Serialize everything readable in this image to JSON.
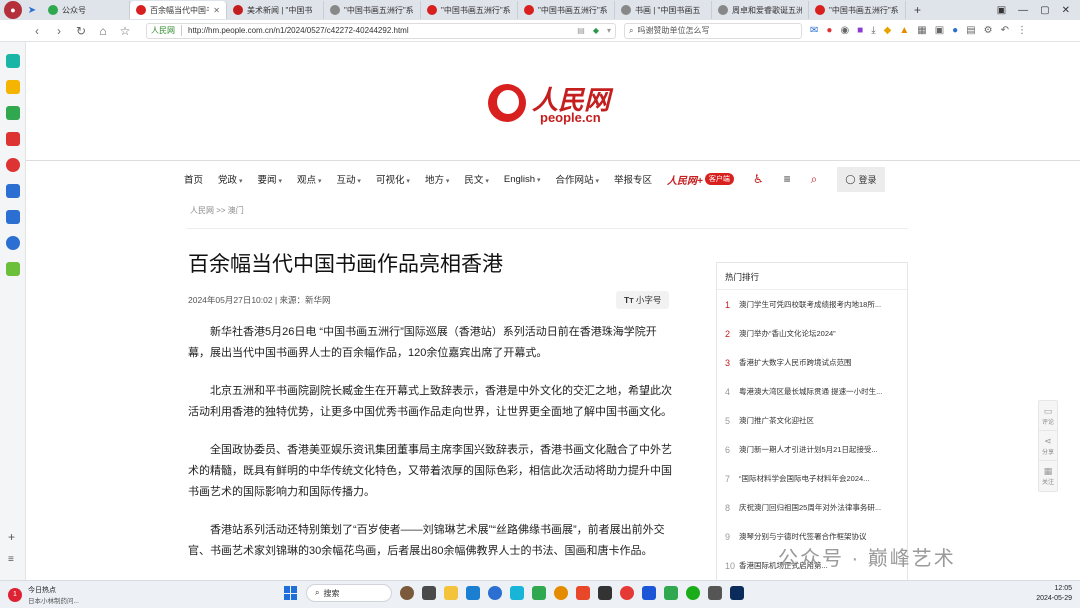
{
  "browser": {
    "tabs": [
      {
        "label": "公众号",
        "color": "#2fa84f"
      },
      {
        "label": "百余幅当代中国书画",
        "color": "#d8201f",
        "active": true
      },
      {
        "label": "美术新闻 | \"中国书",
        "color": "#c41e1e"
      },
      {
        "label": "\"中国书画五洲行\"系",
        "color": "#888888"
      },
      {
        "label": "\"中国书画五洲行\"系",
        "color": "#d8201f"
      },
      {
        "label": "\"中国书画五洲行\"系",
        "color": "#d8201f"
      },
      {
        "label": "书画 | \"中国书画五",
        "color": "#888888"
      },
      {
        "label": "周卓和爱睿歌诞五洲",
        "color": "#888888"
      },
      {
        "label": "\"中国书画五洲行\"系",
        "color": "#d8201f"
      }
    ],
    "site_label": "人民网",
    "url": "http://hm.people.com.cn/n1/2024/0527/c42272-40244292.html",
    "search_placeholder": "吗谢赞助单位怎么写"
  },
  "site": {
    "logo_cn": "人民网",
    "logo_en": "people.cn",
    "nav": [
      {
        "label": "首页",
        "dd": false
      },
      {
        "label": "党政",
        "dd": true
      },
      {
        "label": "要闻",
        "dd": true
      },
      {
        "label": "观点",
        "dd": true
      },
      {
        "label": "互动",
        "dd": true
      },
      {
        "label": "可视化",
        "dd": true
      },
      {
        "label": "地方",
        "dd": true
      },
      {
        "label": "民文",
        "dd": true
      },
      {
        "label": "English",
        "dd": true
      },
      {
        "label": "合作网站",
        "dd": true
      },
      {
        "label": "举报专区",
        "dd": false
      }
    ],
    "client_logo": "人民网+",
    "client_badge": "客户端",
    "login_label": "登录"
  },
  "article": {
    "breadcrumb": "人民网 >> 澳门",
    "title": "百余幅当代中国书画作品亮相香港",
    "meta": "2024年05月27日10:02 | 来源：新华网",
    "font_size_label": "小字号",
    "paragraphs": [
      "新华社香港5月26日电 “中国书画五洲行”国际巡展（香港站）系列活动日前在香港珠海学院开幕，展出当代中国书画界人士的百余幅作品，120余位嘉宾出席了开幕式。",
      "北京五洲和平书画院副院长臧金生在开幕式上致辞表示，香港是中外文化的交汇之地，希望此次活动利用香港的独特优势，让更多中国优秀书画作品走向世界，让世界更全面地了解中国书画文化。",
      "全国政协委员、香港美亚娱乐资讯集团董事局主席李国兴致辞表示，香港书画文化融合了中外艺术的精髓，既具有鲜明的中华传统文化特色，又带着浓厚的国际色彩，相信此次活动将助力提升中国书画艺术的国际影响力和国际传播力。",
      "香港站系列活动还特别策划了“百岁使者——刘锦琳艺术展”“丝路佛缘书画展”，前者展出前外交官、书画艺术家刘锦琳的30余幅花鸟画，后者展出80余幅佛教界人士的书法、国画和唐卡作品。"
    ]
  },
  "hot": {
    "heading": "热门排行",
    "items": [
      {
        "n": "1",
        "text": "澳门学生可凭四校联考成绩报考内地18所..."
      },
      {
        "n": "2",
        "text": "澳门举办“香山文化论坛2024”"
      },
      {
        "n": "3",
        "text": "香港扩大数字人民币跨境试点范围"
      },
      {
        "n": "4",
        "text": "粤港澳大湾区最长城际贯通 提速一小时生..."
      },
      {
        "n": "5",
        "text": "澳门推广茶文化迎社区"
      },
      {
        "n": "6",
        "text": "澳门新一期人才引进计划5月21日起接受..."
      },
      {
        "n": "7",
        "text": "“国际材料学会国际电子材料年会2024..."
      },
      {
        "n": "8",
        "text": "庆祝澳门回归祖国25周年对外法律事务研..."
      },
      {
        "n": "9",
        "text": "澳琴分别与宁德时代签署合作框架协议"
      },
      {
        "n": "10",
        "text": "香港国际机场正式启用第..."
      }
    ]
  },
  "float": {
    "comment": "评论",
    "share": "分享",
    "follow": "关注"
  },
  "watermark": "公众号 · 巅峰艺术",
  "taskbar": {
    "news_badge": "1",
    "news_title": "今日热点",
    "news_sub": "日本小林制药问...",
    "search_label": "搜索",
    "time": "12:05",
    "date": "2024-05-29"
  }
}
